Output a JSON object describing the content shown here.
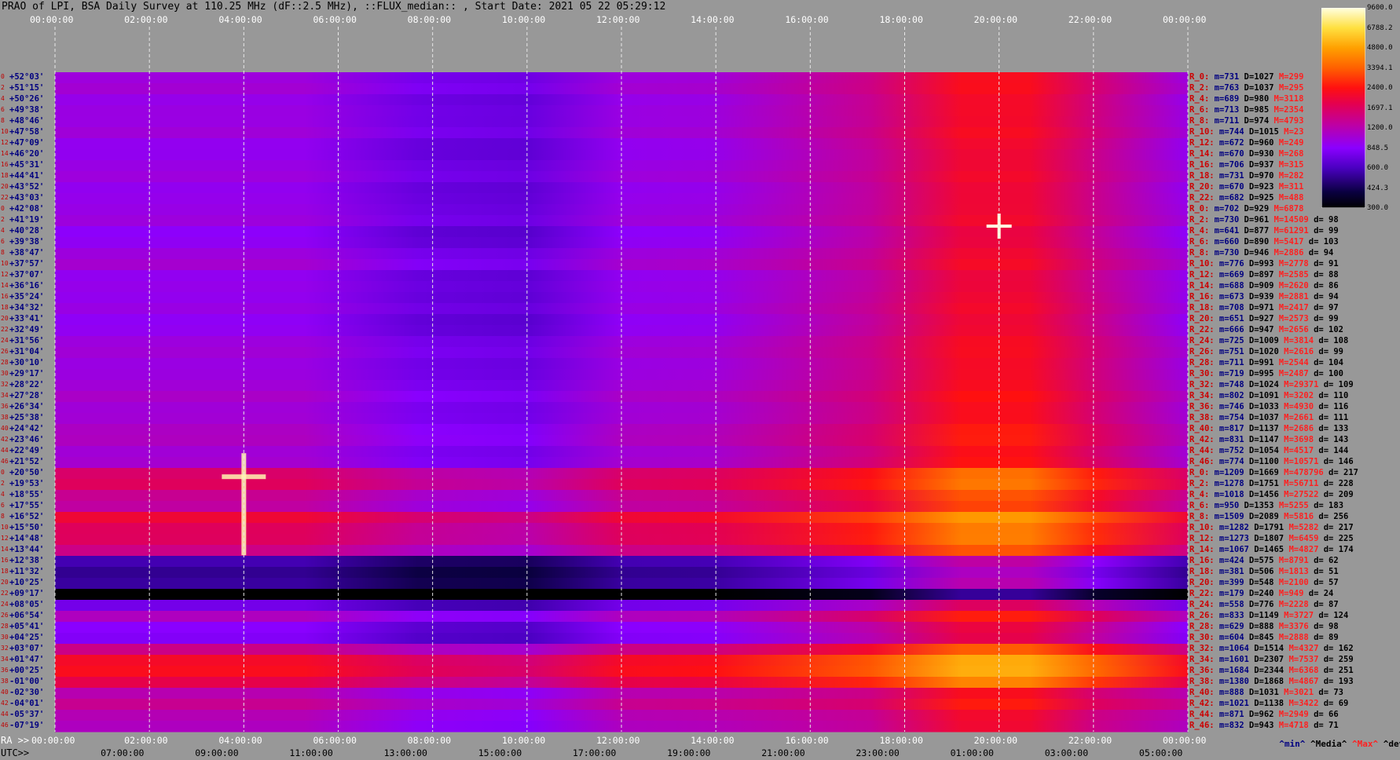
{
  "title": "PRAO of LPI, BSA Daily Survey at 110.25 MHz (dF::2.5 MHz), ::FLUX_median:: , Start Date: 2021 05 22 05:29:12",
  "chart_data": {
    "type": "heatmap",
    "title": "PRAO of LPI, BSA Daily Survey at 110.25 MHz (dF::2.5 MHz), ::FLUX_median:: , Start Date: 2021 05 22 05:29:12",
    "x_axis_top_ra": [
      "00:00:00",
      "02:00:00",
      "04:00:00",
      "06:00:00",
      "08:00:00",
      "10:00:00",
      "12:00:00",
      "14:00:00",
      "16:00:00",
      "18:00:00",
      "20:00:00",
      "22:00:00",
      "00:00:00"
    ],
    "x_axis_bottom_ra": [
      "00:00:00",
      "02:00:00",
      "04:00:00",
      "06:00:00",
      "08:00:00",
      "10:00:00",
      "12:00:00",
      "14:00:00",
      "16:00:00",
      "18:00:00",
      "20:00:00",
      "22:00:00",
      "00:00:00"
    ],
    "x_axis_bottom_utc": [
      "07:00:00",
      "09:00:00",
      "11:00:00",
      "13:00:00",
      "15:00:00",
      "17:00:00",
      "19:00:00",
      "21:00:00",
      "23:00:00",
      "01:00:00",
      "03:00:00",
      "05:00:00"
    ],
    "ra_prefix": "RA >>",
    "utc_prefix": "UTC>>",
    "declinations": [
      "+52°03'",
      "+51°15'",
      "+50°26'",
      "+49°38'",
      "+48°46'",
      "+47°58'",
      "+47°09'",
      "+46°20'",
      "+45°31'",
      "+44°41'",
      "+43°52'",
      "+43°03'",
      "+42°08'",
      "+41°19'",
      "+40°28'",
      "+39°38'",
      "+38°47'",
      "+37°57'",
      "+37°07'",
      "+36°16'",
      "+35°24'",
      "+34°32'",
      "+33°41'",
      "+32°49'",
      "+31°56'",
      "+31°04'",
      "+30°10'",
      "+29°17'",
      "+28°22'",
      "+27°28'",
      "+26°34'",
      "+25°38'",
      "+24°42'",
      "+23°46'",
      "+22°49'",
      "+21°52'",
      "+20°50'",
      "+19°53'",
      "+18°55'",
      "+17°55'",
      "+16°52'",
      "+15°50'",
      "+14°48'",
      "+13°44'",
      "+12°38'",
      "+11°32'",
      "+10°25'",
      "+09°17'",
      "+08°05'",
      "+06°54'",
      "+05°41'",
      "+04°25'",
      "+03°07'",
      "+01°47'",
      "+00°25'",
      "-01°00'",
      "-02°30'",
      "-04°01'",
      "-05°37'",
      "-07°19'"
    ],
    "beam_index": [
      "0",
      "2",
      "4",
      "6",
      "8",
      "10",
      "12",
      "14",
      "16",
      "18",
      "20",
      "22",
      "0",
      "2",
      "4",
      "6",
      "8",
      "10",
      "12",
      "14",
      "16",
      "18",
      "20",
      "22",
      "24",
      "26",
      "28",
      "30",
      "32",
      "34",
      "36",
      "38",
      "40",
      "42",
      "44",
      "46",
      "0",
      "2",
      "4",
      "6",
      "8",
      "10",
      "12",
      "14",
      "16",
      "18",
      "20",
      "22",
      "24",
      "26",
      "28",
      "30",
      "32",
      "34",
      "36",
      "38",
      "40",
      "42",
      "44",
      "46"
    ],
    "row_stats": [
      {
        "r": "R_0:",
        "m": "m=731",
        "D": "D=1027",
        "M": "M=299",
        "d": ""
      },
      {
        "r": "R_2:",
        "m": "m=763",
        "D": "D=1037",
        "M": "M=295",
        "d": ""
      },
      {
        "r": "R_4:",
        "m": "m=689",
        "D": "D=980",
        "M": "M=3118",
        "d": ""
      },
      {
        "r": "R_6:",
        "m": "m=713",
        "D": "D=985",
        "M": "M=2354",
        "d": ""
      },
      {
        "r": "R_8:",
        "m": "m=711",
        "D": "D=974",
        "M": "M=4793",
        "d": ""
      },
      {
        "r": "R_10:",
        "m": "m=744",
        "D": "D=1015",
        "M": "M=23",
        "d": ""
      },
      {
        "r": "R_12:",
        "m": "m=672",
        "D": "D=960",
        "M": "M=249",
        "d": ""
      },
      {
        "r": "R_14:",
        "m": "m=670",
        "D": "D=930",
        "M": "M=268",
        "d": ""
      },
      {
        "r": "R_16:",
        "m": "m=706",
        "D": "D=937",
        "M": "M=315",
        "d": ""
      },
      {
        "r": "R_18:",
        "m": "m=731",
        "D": "D=970",
        "M": "M=282",
        "d": ""
      },
      {
        "r": "R_20:",
        "m": "m=670",
        "D": "D=923",
        "M": "M=311",
        "d": ""
      },
      {
        "r": "R_22:",
        "m": "m=682",
        "D": "D=925",
        "M": "M=488",
        "d": ""
      },
      {
        "r": "R_0:",
        "m": "m=702",
        "D": "D=929",
        "M": "M=6878",
        "d": ""
      },
      {
        "r": "R_2:",
        "m": "m=730",
        "D": "D=961",
        "M": "M=14509",
        "d": "d= 98"
      },
      {
        "r": "R_4:",
        "m": "m=641",
        "D": "D=877",
        "M": "M=61291",
        "d": "d= 99"
      },
      {
        "r": "R_6:",
        "m": "m=660",
        "D": "D=890",
        "M": "M=5417",
        "d": "d= 103"
      },
      {
        "r": "R_8:",
        "m": "m=730",
        "D": "D=946",
        "M": "M=2886",
        "d": "d= 94"
      },
      {
        "r": "R_10:",
        "m": "m=776",
        "D": "D=993",
        "M": "M=2778",
        "d": "d= 91"
      },
      {
        "r": "R_12:",
        "m": "m=669",
        "D": "D=897",
        "M": "M=2585",
        "d": "d= 88"
      },
      {
        "r": "R_14:",
        "m": "m=688",
        "D": "D=909",
        "M": "M=2620",
        "d": "d= 86"
      },
      {
        "r": "R_16:",
        "m": "m=673",
        "D": "D=939",
        "M": "M=2881",
        "d": "d= 94"
      },
      {
        "r": "R_18:",
        "m": "m=708",
        "D": "D=971",
        "M": "M=2417",
        "d": "d= 97"
      },
      {
        "r": "R_20:",
        "m": "m=651",
        "D": "D=927",
        "M": "M=2573",
        "d": "d= 99"
      },
      {
        "r": "R_22:",
        "m": "m=666",
        "D": "D=947",
        "M": "M=2656",
        "d": "d= 102"
      },
      {
        "r": "R_24:",
        "m": "m=725",
        "D": "D=1009",
        "M": "M=3814",
        "d": "d= 108"
      },
      {
        "r": "R_26:",
        "m": "m=751",
        "D": "D=1020",
        "M": "M=2616",
        "d": "d= 99"
      },
      {
        "r": "R_28:",
        "m": "m=711",
        "D": "D=991",
        "M": "M=2544",
        "d": "d= 104"
      },
      {
        "r": "R_30:",
        "m": "m=719",
        "D": "D=995",
        "M": "M=2487",
        "d": "d= 100"
      },
      {
        "r": "R_32:",
        "m": "m=748",
        "D": "D=1024",
        "M": "M=29371",
        "d": "d= 109"
      },
      {
        "r": "R_34:",
        "m": "m=802",
        "D": "D=1091",
        "M": "M=3202",
        "d": "d= 110"
      },
      {
        "r": "R_36:",
        "m": "m=746",
        "D": "D=1033",
        "M": "M=4930",
        "d": "d= 116"
      },
      {
        "r": "R_38:",
        "m": "m=754",
        "D": "D=1037",
        "M": "M=2661",
        "d": "d= 111"
      },
      {
        "r": "R_40:",
        "m": "m=817",
        "D": "D=1137",
        "M": "M=2686",
        "d": "d= 133"
      },
      {
        "r": "R_42:",
        "m": "m=831",
        "D": "D=1147",
        "M": "M=3698",
        "d": "d= 143"
      },
      {
        "r": "R_44:",
        "m": "m=752",
        "D": "D=1054",
        "M": "M=4517",
        "d": "d= 144"
      },
      {
        "r": "R_46:",
        "m": "m=774",
        "D": "D=1100",
        "M": "M=10571",
        "d": "d= 146"
      },
      {
        "r": "R_0:",
        "m": "m=1209",
        "D": "D=1669",
        "M": "M=478796",
        "d": "d= 217"
      },
      {
        "r": "R_2:",
        "m": "m=1278",
        "D": "D=1751",
        "M": "M=56711",
        "d": "d= 228"
      },
      {
        "r": "R_4:",
        "m": "m=1018",
        "D": "D=1456",
        "M": "M=27522",
        "d": "d= 209"
      },
      {
        "r": "R_6:",
        "m": "m=950",
        "D": "D=1353",
        "M": "M=5255",
        "d": "d= 183"
      },
      {
        "r": "R_8:",
        "m": "m=1509",
        "D": "D=2089",
        "M": "M=5816",
        "d": "d= 256"
      },
      {
        "r": "R_10:",
        "m": "m=1282",
        "D": "D=1791",
        "M": "M=5282",
        "d": "d= 217"
      },
      {
        "r": "R_12:",
        "m": "m=1273",
        "D": "D=1807",
        "M": "M=6459",
        "d": "d= 225"
      },
      {
        "r": "R_14:",
        "m": "m=1067",
        "D": "D=1465",
        "M": "M=4827",
        "d": "d= 174"
      },
      {
        "r": "R_16:",
        "m": "m=424",
        "D": "D=575",
        "M": "M=8791",
        "d": "d= 62"
      },
      {
        "r": "R_18:",
        "m": "m=381",
        "D": "D=506",
        "M": "M=1813",
        "d": "d= 51"
      },
      {
        "r": "R_20:",
        "m": "m=399",
        "D": "D=548",
        "M": "M=2100",
        "d": "d= 57"
      },
      {
        "r": "R_22:",
        "m": "m=179",
        "D": "D=240",
        "M": "M=949",
        "d": "d= 24"
      },
      {
        "r": "R_24:",
        "m": "m=558",
        "D": "D=776",
        "M": "M=2228",
        "d": "d= 87"
      },
      {
        "r": "R_26:",
        "m": "m=833",
        "D": "D=1149",
        "M": "M=3727",
        "d": "d= 124"
      },
      {
        "r": "R_28:",
        "m": "m=629",
        "D": "D=888",
        "M": "M=3376",
        "d": "d= 98"
      },
      {
        "r": "R_30:",
        "m": "m=604",
        "D": "D=845",
        "M": "M=2888",
        "d": "d= 89"
      },
      {
        "r": "R_32:",
        "m": "m=1064",
        "D": "D=1514",
        "M": "M=4327",
        "d": "d= 162"
      },
      {
        "r": "R_34:",
        "m": "m=1601",
        "D": "D=2307",
        "M": "M=7537",
        "d": "d= 259"
      },
      {
        "r": "R_36:",
        "m": "m=1684",
        "D": "D=2344",
        "M": "M=6368",
        "d": "d= 251"
      },
      {
        "r": "R_38:",
        "m": "m=1380",
        "D": "D=1868",
        "M": "M=4867",
        "d": "d= 193"
      },
      {
        "r": "R_40:",
        "m": "m=888",
        "D": "D=1031",
        "M": "M=3021",
        "d": "d= 73"
      },
      {
        "r": "R_42:",
        "m": "m=1021",
        "D": "D=1138",
        "M": "M=3422",
        "d": "d= 69"
      },
      {
        "r": "R_44:",
        "m": "m=871",
        "D": "D=962",
        "M": "M=2949",
        "d": "d= 66"
      },
      {
        "r": "R_46:",
        "m": "m=832",
        "D": "D=943",
        "M": "M=4718",
        "d": "d= 71"
      }
    ],
    "colorbar_ticks": [
      "9600.0",
      "6788.2",
      "4800.0",
      "3394.1",
      "2400.0",
      "1697.1",
      "1200.0",
      "848.5",
      "600.0",
      "424.3",
      "300.0"
    ],
    "stat_legend": {
      "min": "^min^",
      "median": "^Media^",
      "max": "^Max^",
      "devia": "^devia^"
    }
  }
}
